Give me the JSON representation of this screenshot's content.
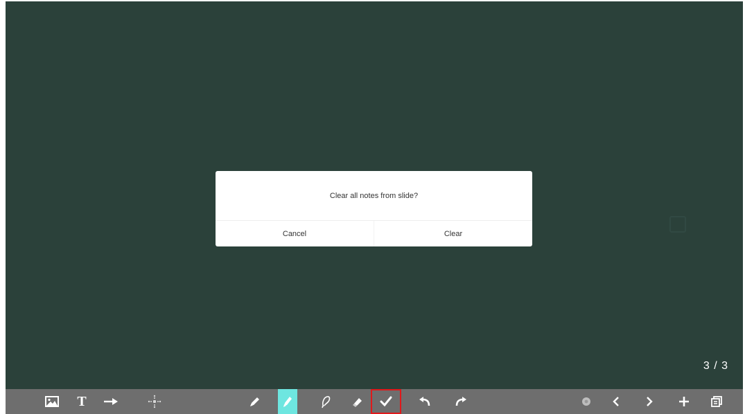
{
  "dialog": {
    "message": "Clear all notes from slide?",
    "cancel_label": "Cancel",
    "clear_label": "Clear"
  },
  "page_indicator": "3 / 3",
  "toolbar": {
    "text_tool_glyph": "T",
    "left_tools": [
      "image-icon",
      "text-icon",
      "arrow-icon",
      "move-icon"
    ],
    "center_tools": [
      "pen-icon",
      "highlighter-icon",
      "lasso-icon",
      "eraser-icon",
      "clear-all-icon",
      "undo-icon",
      "redo-icon"
    ],
    "right_tools": [
      "settings-icon",
      "previous-page-icon",
      "next-page-icon",
      "add-page-icon",
      "pages-icon"
    ],
    "active_tool": "highlighter-icon",
    "selected_tool": "clear-all-icon"
  },
  "colors": {
    "board_background": "#2b413a",
    "toolbar_background": "#6e6e6e",
    "active_highlight": "#6ee6e0",
    "selected_outline": "#e0191b"
  }
}
